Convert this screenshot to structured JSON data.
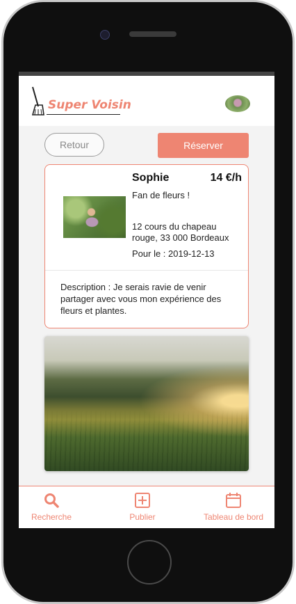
{
  "app": {
    "title": "Super Voisin"
  },
  "actions": {
    "back_label": "Retour",
    "reserve_label": "Réserver"
  },
  "offer": {
    "host_name": "Sophie",
    "price": "14 €/h",
    "tagline": "Fan de fleurs !",
    "address": "12 cours du chapeau rouge, 33 000 Bordeaux",
    "date_line": "Pour le : 2019-12-13",
    "description": "Description : Je serais ravie de venir partager avec vous mon expérience des fleurs et plantes."
  },
  "nav": {
    "items": [
      {
        "label": "Recherche",
        "icon": "search-icon"
      },
      {
        "label": "Publier",
        "icon": "plus-square-icon"
      },
      {
        "label": "Tableau de bord",
        "icon": "calendar-icon"
      }
    ]
  },
  "colors": {
    "accent": "#ee8572",
    "screen_background": "#f3f3f3",
    "card_border": "#ee8572"
  }
}
